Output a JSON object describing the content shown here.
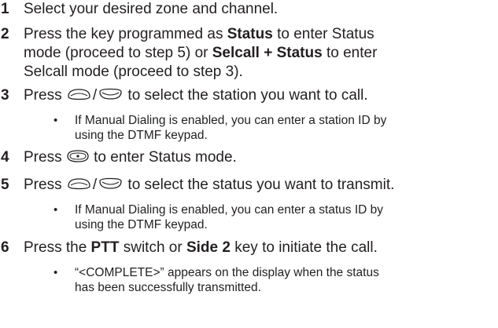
{
  "steps": [
    {
      "num": "1",
      "text": "Select your desired zone and channel."
    },
    {
      "num": "2",
      "line1_a": "Press the key programmed as ",
      "line1_b": "Status",
      "line1_c": " to enter Status",
      "line2_a": "mode (proceed to step 5) or ",
      "line2_b": "Selcall + Status",
      "line2_c": " to enter",
      "line3": "Selcall mode (proceed to step 3)."
    },
    {
      "num": "3",
      "press": "Press ",
      "slash": "/",
      "rest": " to select the station you want to call.",
      "bullet_line1": "If Manual Dialing is enabled, you can enter a station ID by",
      "bullet_line2": "using the DTMF keypad."
    },
    {
      "num": "4",
      "press": "Press ",
      "rest": " to enter Status mode."
    },
    {
      "num": "5",
      "press": "Press ",
      "slash": "/",
      "rest": " to select the status you want to transmit.",
      "bullet_line1": "If Manual Dialing is enabled, you can enter a status ID by",
      "bullet_line2": "using the DTMF keypad."
    },
    {
      "num": "6",
      "a": "Press the ",
      "b": "PTT",
      "c": " switch or ",
      "d": "Side 2",
      "e": " key to initiate the call.",
      "bullet_line1": "“<COMPLETE>” appears on the display when the status",
      "bullet_line2": "has been successfully transmitted."
    }
  ],
  "bullet_glyph": "•",
  "icons": {
    "up": "up-arrow-key-icon",
    "down": "down-arrow-key-icon",
    "ok": "ok-key-icon"
  }
}
